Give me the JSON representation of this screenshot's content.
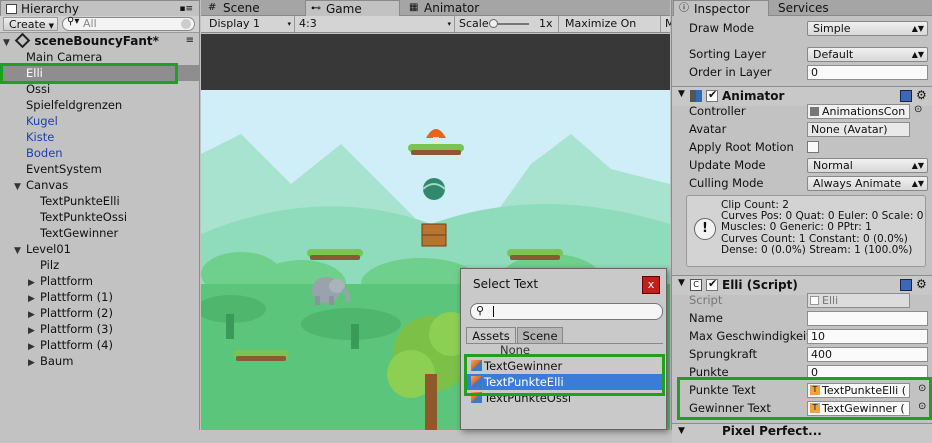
{
  "hierarchy": {
    "tab": "Hierarchy",
    "create": "Create",
    "search_placeholder": "All",
    "scene": "sceneBouncyFant*",
    "items": [
      {
        "label": "Main Camera",
        "indent": 1,
        "arrow": "",
        "color": ""
      },
      {
        "label": "Elli",
        "indent": 1,
        "arrow": "",
        "color": "",
        "selected": true
      },
      {
        "label": "Ossi",
        "indent": 1,
        "arrow": "",
        "color": ""
      },
      {
        "label": "Spielfeldgrenzen",
        "indent": 1,
        "arrow": "",
        "color": ""
      },
      {
        "label": "Kugel",
        "indent": 1,
        "arrow": "",
        "color": "blue"
      },
      {
        "label": "Kiste",
        "indent": 1,
        "arrow": "",
        "color": "blue"
      },
      {
        "label": "Boden",
        "indent": 1,
        "arrow": "",
        "color": "blue"
      },
      {
        "label": "EventSystem",
        "indent": 1,
        "arrow": "",
        "color": ""
      },
      {
        "label": "Canvas",
        "indent": 1,
        "arrow": "▼",
        "color": ""
      },
      {
        "label": "TextPunkteElli",
        "indent": 2,
        "arrow": "",
        "color": ""
      },
      {
        "label": "TextPunkteOssi",
        "indent": 2,
        "arrow": "",
        "color": ""
      },
      {
        "label": "TextGewinner",
        "indent": 2,
        "arrow": "",
        "color": ""
      },
      {
        "label": "Level01",
        "indent": 1,
        "arrow": "▼",
        "color": ""
      },
      {
        "label": "Pilz",
        "indent": 2,
        "arrow": "",
        "color": ""
      },
      {
        "label": "Plattform",
        "indent": 2,
        "arrow": "▶",
        "color": ""
      },
      {
        "label": "Plattform (1)",
        "indent": 2,
        "arrow": "▶",
        "color": ""
      },
      {
        "label": "Plattform (2)",
        "indent": 2,
        "arrow": "▶",
        "color": ""
      },
      {
        "label": "Plattform (3)",
        "indent": 2,
        "arrow": "▶",
        "color": ""
      },
      {
        "label": "Plattform (4)",
        "indent": 2,
        "arrow": "▶",
        "color": ""
      },
      {
        "label": "Baum",
        "indent": 2,
        "arrow": "▶",
        "color": ""
      }
    ]
  },
  "center": {
    "tabs": [
      "Scene",
      "Game",
      "Animator"
    ],
    "display": "Display 1",
    "aspect": "4:3",
    "scale_label": "Scale",
    "scale_value": "1x",
    "maximize": "Maximize On Play",
    "cut": "M"
  },
  "popup": {
    "title": "Select Text",
    "close": "x",
    "tabs": [
      "Assets",
      "Scene"
    ],
    "items": [
      "None",
      "TextGewinner",
      "TextPunkteElli",
      "TextPunkteOssi"
    ]
  },
  "inspector": {
    "tabs": [
      "Inspector",
      "Services"
    ],
    "draw_mode": {
      "label": "Draw Mode",
      "value": "Simple"
    },
    "sorting_layer": {
      "label": "Sorting Layer",
      "value": "Default"
    },
    "order_in_layer": {
      "label": "Order in Layer",
      "value": "0"
    },
    "animator": {
      "title": "Animator",
      "controller": {
        "label": "Controller",
        "value": "AnimationsCon"
      },
      "avatar": {
        "label": "Avatar",
        "value": "None (Avatar)"
      },
      "apply_root_motion": {
        "label": "Apply Root Motion"
      },
      "update_mode": {
        "label": "Update Mode",
        "value": "Normal"
      },
      "culling_mode": {
        "label": "Culling Mode",
        "value": "Always Animate"
      },
      "info": [
        "Clip Count: 2",
        "Curves Pos: 0 Quat: 0 Euler: 0 Scale: 0",
        "Muscles: 0 Generic: 0 PPtr: 1",
        "Curves Count: 1 Constant: 0 (0.0%)",
        "Dense: 0 (0.0%) Stream: 1 (100.0%)"
      ]
    },
    "script_comp": {
      "title": "Elli (Script)",
      "script": {
        "label": "Script",
        "value": "Elli"
      },
      "name": {
        "label": "Name",
        "value": ""
      },
      "max_speed": {
        "label": "Max Geschwindigkeit",
        "value": "10"
      },
      "jump": {
        "label": "Sprungkraft",
        "value": "400"
      },
      "points": {
        "label": "Punkte",
        "value": "0"
      },
      "points_text": {
        "label": "Punkte Text",
        "value": "TextPunkteElli ("
      },
      "winner_text": {
        "label": "Gewinner Text",
        "value": "TextGewinner ("
      }
    },
    "next_comp": "Pixel Perfect..."
  },
  "colors": {
    "highlight": "#1ea21e",
    "selection": "#3d7bd9",
    "sky": "#cfeef7"
  }
}
